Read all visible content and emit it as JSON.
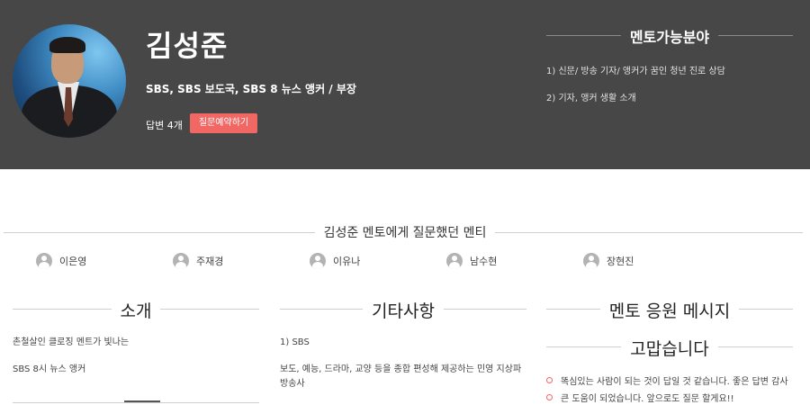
{
  "profile": {
    "name": "김성준",
    "affiliation": "SBS, SBS 보도국, SBS 8 뉴스 앵커 / 부장",
    "answers": "답변 4개",
    "reserve_button": "질문예약하기"
  },
  "mentor_fields": {
    "title": "멘토가능분야",
    "items": [
      "1) 신문/ 방송 기자/ 앵커가 꿈인 청년 진로 상담",
      "2) 기자, 앵커 생활 소개"
    ]
  },
  "mentees": {
    "title": "김성준 멘토에게 질문했던 멘티",
    "names": [
      "이은영",
      "주재경",
      "이유나",
      "남수현",
      "장현진"
    ]
  },
  "intro": {
    "title": "소개",
    "lines": [
      "촌철살인 클로징 멘트가 빛나는",
      "SBS 8시 뉴스 앵커"
    ]
  },
  "etc": {
    "title": "기타사항",
    "lines": [
      "1) SBS",
      "보도, 예능, 드라마, 교양 등을 종합 편성해 제공하는 민영 지상파 방송사"
    ]
  },
  "cheer": {
    "title": "멘토 응원 메시지",
    "subtitle": "고맙습니다",
    "messages": [
      "똑심있는 사람이 되는 것이 답일 것 같습니다. 좋은 답변 감사",
      "큰 도움이 되었습니다. 앞으로도 질문 할게요!!"
    ]
  },
  "colors": {
    "header_bg": "#474747",
    "accent": "#f06764"
  }
}
